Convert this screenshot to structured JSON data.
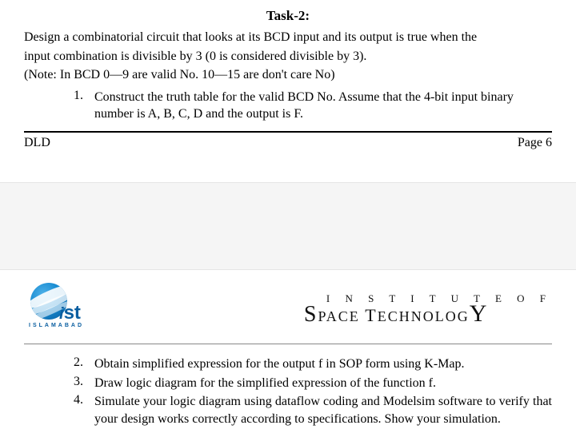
{
  "task": {
    "heading": "Task-2:",
    "intro_line1": "Design a combinatorial circuit that looks at its BCD input and its output is true when the",
    "intro_line2": "input combination is divisible by 3 (0 is considered divisible by 3).",
    "note": "(Note: In BCD 0—9 are valid No. 10—15 are don't care No)",
    "items": [
      {
        "num": "1.",
        "text": "Construct the truth table for the valid BCD No. Assume that the 4-bit input binary number is A, B, C, D and the output is F."
      },
      {
        "num": "2.",
        "text": "Obtain simplified expression for the output f in SOP form using K-Map."
      },
      {
        "num": "3.",
        "text": "Draw logic diagram for the simplified expression of the function f."
      },
      {
        "num": "4.",
        "text": "Simulate your logic diagram using dataflow coding and Modelsim software to verify that your design works correctly according to specifications. Show your simulation."
      }
    ]
  },
  "footer": {
    "left": "DLD",
    "right": "Page 6"
  },
  "logo": {
    "text": "ist",
    "subtext": "ISLAMABAD"
  },
  "institute": {
    "line1": "I N S T I T U T E  O F",
    "line2_lead": "S",
    "line2_mid1": "PACE ",
    "line2_T": "T",
    "line2_mid2": "ECHNOLOG",
    "line2_Y": "Y"
  }
}
